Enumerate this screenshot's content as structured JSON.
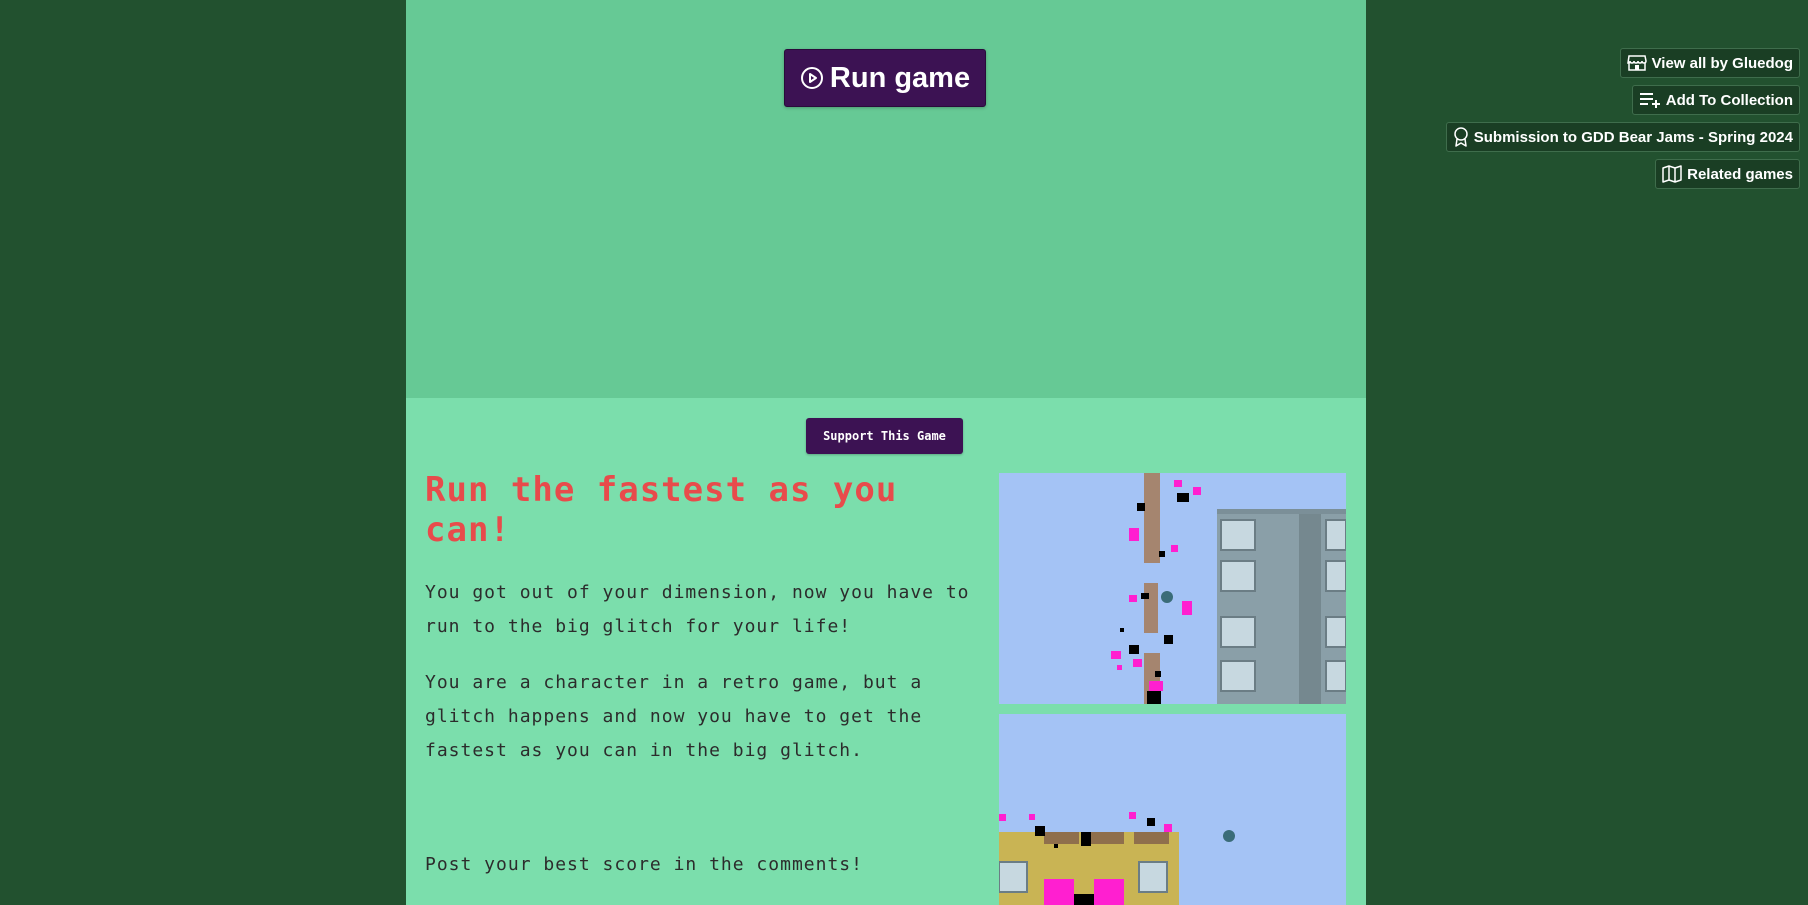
{
  "embed": {
    "run_label": "Run game"
  },
  "support": {
    "label": "Support This Game"
  },
  "description": {
    "heading": "Run the fastest as you can!",
    "paragraphs": [
      "You got out of your dimension, now you have to run to the big glitch for your life!",
      "You are a character in a retro game, but a glitch happens and now you have to get the fastest as you can in the big glitch.",
      "Post your best score in the comments!"
    ]
  },
  "sidebar": {
    "view_all": "View all by Gluedog",
    "add_collection": "Add To Collection",
    "submission": "Submission to GDD Bear Jams - Spring 2024",
    "related": "Related games"
  },
  "colors": {
    "background": "#22512f",
    "main": "#7bdeac",
    "embed": "#66c995",
    "button": "#3c1253",
    "heading": "#e84b4b"
  },
  "icons": [
    "play-circle-icon",
    "itchio-store-icon",
    "playlist-add-icon",
    "award-ribbon-icon",
    "map-icon"
  ]
}
